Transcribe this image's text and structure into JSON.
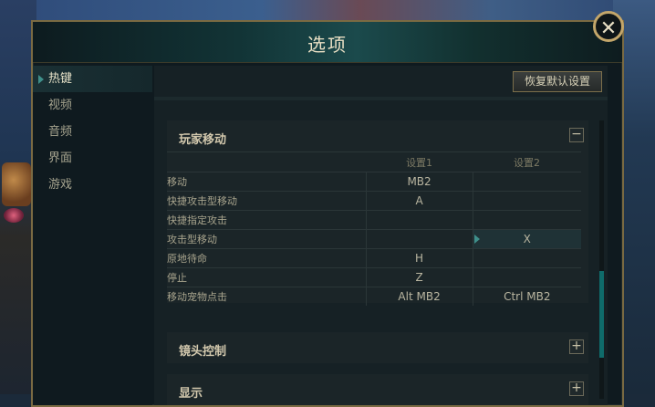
{
  "window": {
    "title": "选项",
    "close_glyph": "✕"
  },
  "sidebar": {
    "items": [
      {
        "label": "热键",
        "active": true
      },
      {
        "label": "视频",
        "active": false
      },
      {
        "label": "音频",
        "active": false
      },
      {
        "label": "界面",
        "active": false
      },
      {
        "label": "游戏",
        "active": false
      }
    ]
  },
  "toolbar": {
    "reset_label": "恢复默认设置"
  },
  "sections": {
    "player_movement": {
      "title": "玩家移动",
      "toggle": "−",
      "columns": [
        "设置1",
        "设置2"
      ],
      "rows": [
        {
          "label": "移动",
          "set1": "MB2",
          "set2": ""
        },
        {
          "label": "快捷攻击型移动",
          "set1": "A",
          "set2": ""
        },
        {
          "label": "快捷指定攻击",
          "set1": "",
          "set2": ""
        },
        {
          "label": "攻击型移动",
          "set1": "",
          "set2": "X"
        },
        {
          "label": "原地待命",
          "set1": "H",
          "set2": ""
        },
        {
          "label": "停止",
          "set1": "Z",
          "set2": ""
        },
        {
          "label": "移动宠物点击",
          "set1": "Alt  MB2",
          "set2": "Ctrl  MB2"
        }
      ]
    },
    "camera": {
      "title": "镜头控制",
      "toggle": "+"
    },
    "display": {
      "title": "显示",
      "toggle": "+"
    }
  },
  "colors": {
    "accent_teal": "#0f6b6a",
    "gold_border": "#c3a66a"
  }
}
